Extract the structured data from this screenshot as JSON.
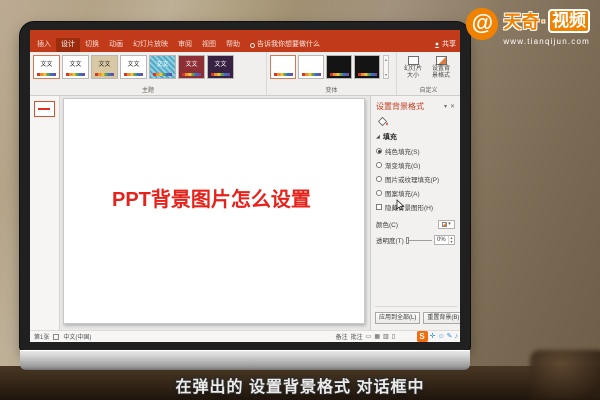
{
  "brand": {
    "name": "天奇",
    "dot": "·",
    "badge": "视频",
    "website": "www.tianqijun.com",
    "accent_color": "#f08200"
  },
  "subtitle": "在弹出的 设置背景格式 对话框中",
  "ppt": {
    "tabs": [
      "插入",
      "设计",
      "切换",
      "动画",
      "幻灯片放映",
      "审阅",
      "视图",
      "帮助"
    ],
    "active_tab": "设计",
    "tell_me": "告诉我你想要做什么",
    "share_label": "共享",
    "ribbon": {
      "themes_label": "主题",
      "variants_label": "变体",
      "customize_label": "自定义",
      "slide_size_label": "幻灯片大小",
      "format_background_label": "设置背景格式",
      "theme_preview_text": "文文"
    },
    "slide_title": "PPT背景图片怎么设置",
    "pane": {
      "title": "设置背景格式",
      "fill_header": "填充",
      "options": [
        {
          "label": "纯色填充(S)",
          "type": "radio",
          "checked": true
        },
        {
          "label": "渐变填充(G)",
          "type": "radio",
          "checked": false
        },
        {
          "label": "图片或纹理填充(P)",
          "type": "radio",
          "checked": false
        },
        {
          "label": "图案填充(A)",
          "type": "radio",
          "checked": false
        },
        {
          "label": "隐藏背景图形(H)",
          "type": "checkbox",
          "checked": false
        }
      ],
      "color_label": "颜色(C)",
      "transparency_label": "透明度(T)",
      "transparency_value": "0%",
      "apply_all_label": "应用到全部(L)",
      "reset_label": "重置背景(B)"
    },
    "status": {
      "slide_counter": "第1张",
      "language": "中文(中国)",
      "notes_label": "备注",
      "comments_label": "批注"
    }
  },
  "icons": {
    "pane_dropdown": "▾",
    "pane_close": "✕",
    "fill_collapse": "◢",
    "spin_up": "▴",
    "spin_down": "▾",
    "gallery_up": "▴",
    "gallery_down": "▾",
    "view_icons": [
      "▭",
      "▦",
      "▥",
      "▯"
    ],
    "sogou_logo": "S",
    "ime_icons": [
      "✛",
      "☺",
      "✎",
      "♪"
    ]
  },
  "colors": {
    "titlebar": "#c13a1a",
    "active_tab": "#9c2c0e",
    "pane_title": "#c0391d",
    "slide_title_red": "#e8211a",
    "sogou_orange": "#f26c0d",
    "ime_blue": "#3a8fd8"
  }
}
